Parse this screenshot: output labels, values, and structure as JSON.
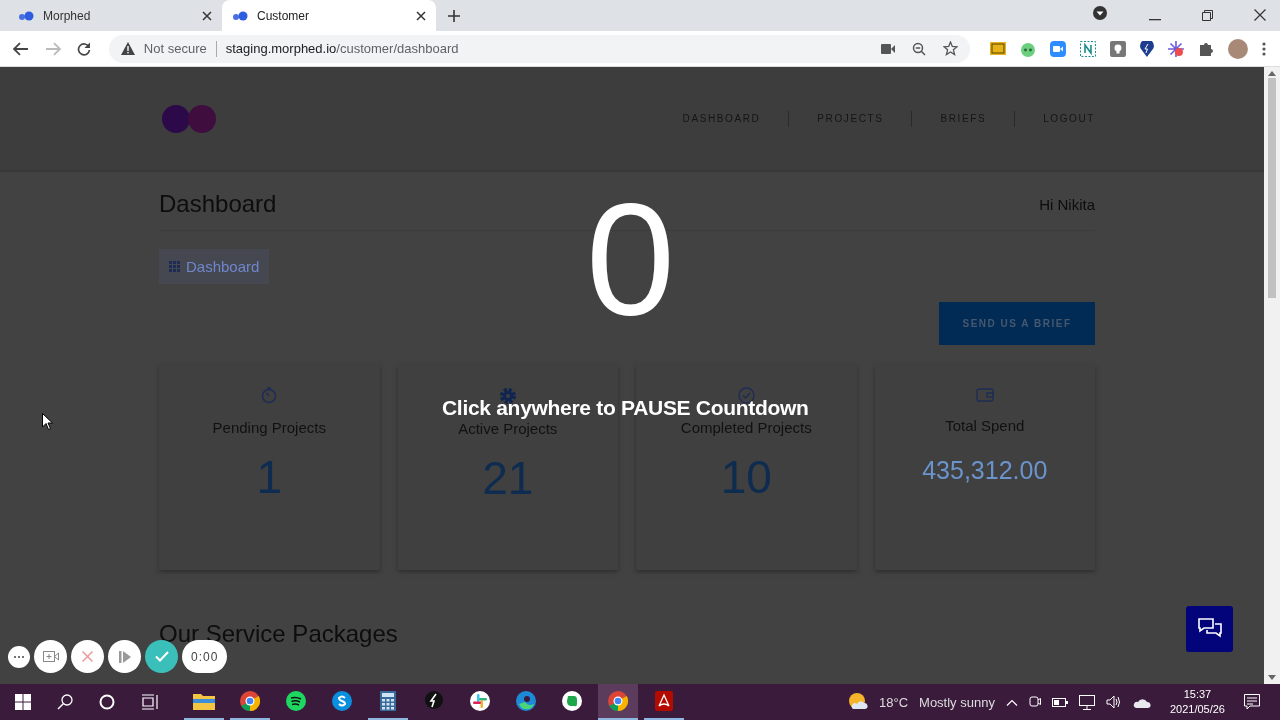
{
  "browser": {
    "tabs": [
      {
        "title": "Morphed",
        "selected": false
      },
      {
        "title": "Customer",
        "selected": true
      }
    ],
    "security": "Not secure",
    "url_host": "staging.morphed.io",
    "url_path": "/customer/dashboard"
  },
  "nav": {
    "items": [
      "DASHBOARD",
      "PROJECTS",
      "BRIEFS",
      "LOGOUT"
    ]
  },
  "page": {
    "title": "Dashboard",
    "greeting": "Hi Nikita",
    "breadcrumb": "Dashboard",
    "cta": "SEND US A BRIEF",
    "stats": [
      {
        "label": "Pending Projects",
        "value": "1",
        "kind": "count"
      },
      {
        "label": "Active Projects",
        "value": "21",
        "kind": "count"
      },
      {
        "label": "Completed Projects",
        "value": "10",
        "kind": "count"
      },
      {
        "label": "Total Spend",
        "value": "435,312.00",
        "kind": "amount"
      }
    ],
    "section_title": "Our Service Packages"
  },
  "countdown": {
    "number": "0",
    "hint": "Click anywhere to PAUSE Countdown"
  },
  "recorder": {
    "timer": "0:00"
  },
  "taskbar": {
    "apps": [
      {
        "kind": "explorer",
        "running": true,
        "selected": false
      },
      {
        "kind": "chrome",
        "running": true,
        "selected": false
      },
      {
        "kind": "spotify",
        "running": false,
        "selected": false
      },
      {
        "kind": "skype",
        "running": false,
        "selected": false
      },
      {
        "kind": "calculator",
        "running": true,
        "selected": false
      },
      {
        "kind": "bolt",
        "running": false,
        "selected": false
      },
      {
        "kind": "slack",
        "running": false,
        "selected": false
      },
      {
        "kind": "edge",
        "running": false,
        "selected": false
      },
      {
        "kind": "evernote",
        "running": false,
        "selected": false
      },
      {
        "kind": "chrome",
        "running": true,
        "selected": true
      },
      {
        "kind": "acrobat",
        "running": true,
        "selected": false
      }
    ],
    "temperature": "18°C",
    "weather": "Mostly sunny",
    "time": "15:37",
    "date": "2021/05/26"
  }
}
